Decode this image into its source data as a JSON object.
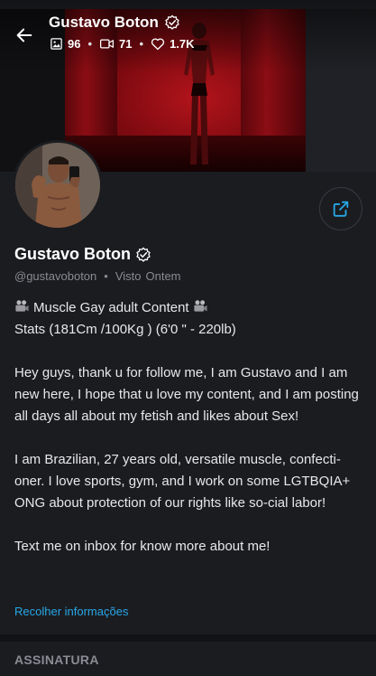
{
  "header": {
    "title": "Gustavo Boton",
    "stats": {
      "photos": "96",
      "videos": "71",
      "likes": "1.7K"
    }
  },
  "profile": {
    "name": "Gustavo Boton",
    "handle": "@gustavoboton",
    "last_seen_label": "Visto",
    "last_seen_value": "Ontem"
  },
  "bio": {
    "line1": "Muscle Gay adult Content",
    "line2": "Stats (181Cm /100Kg ) (6'0 \" - 220lb)",
    "para1": "Hey guys, thank u for follow me, I am Gustavo and I am new here, I hope that u love my content, and I am posting all days all about my fetish and likes about Sex!",
    "para2": "I am Brazilian, 27 years old, versatile muscle, confecti-oner. I love sports, gym, and I work on some LGTBQIA+ ONG about protection of our rights like so-cial labor!",
    "para3": "Text me on inbox for know more about me!"
  },
  "collapse_link": "Recolher informações",
  "section_title": "ASSINATURA",
  "colors": {
    "background": "#1b1c20",
    "accent": "#27a7e7",
    "muted": "#8a8b93"
  },
  "icons": [
    "back-arrow-icon",
    "verified-icon",
    "image-icon",
    "video-icon",
    "heart-icon",
    "share-icon",
    "movie-camera-icon"
  ]
}
